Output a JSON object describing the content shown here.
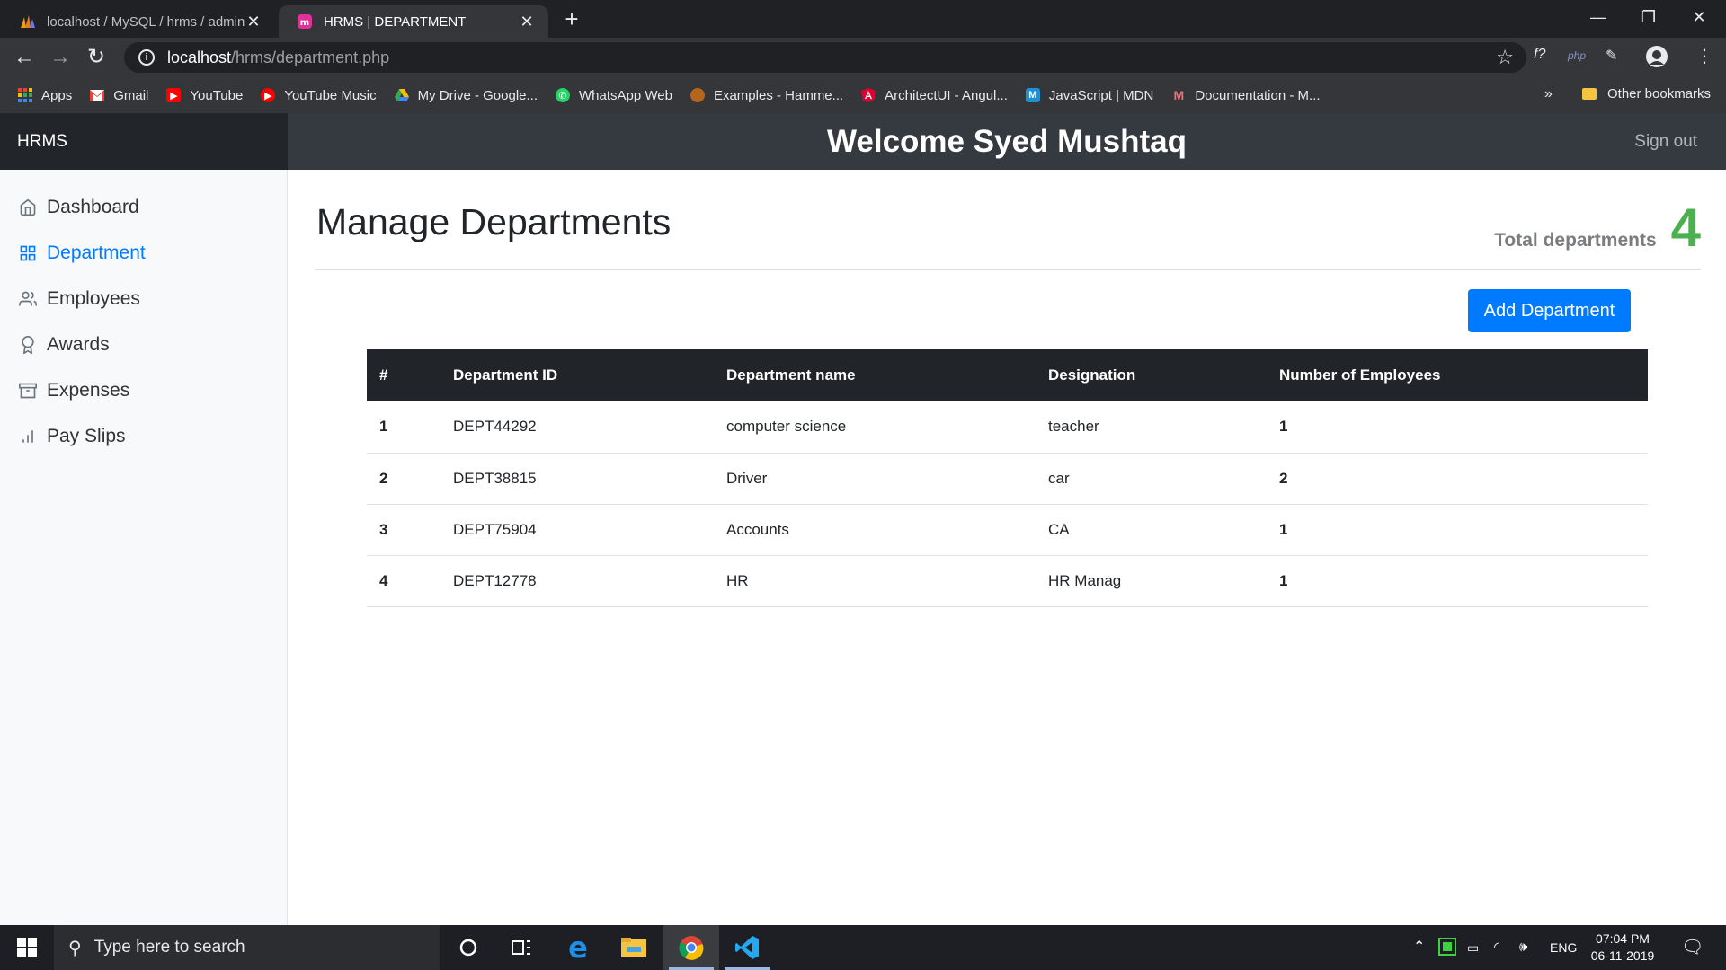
{
  "browser": {
    "tabs": [
      {
        "title": "localhost / MySQL / hrms / admin",
        "active": false,
        "icon": "phpmyadmin-icon"
      },
      {
        "title": "HRMS | DEPARTMENT",
        "active": true,
        "icon": "hrms-favicon-icon"
      }
    ],
    "url_host": "localhost",
    "url_path": "/hrms/department.php",
    "bookmarks": [
      {
        "label": "Apps",
        "icon": "apps-grid-icon",
        "color": "#ea4335"
      },
      {
        "label": "Gmail",
        "icon": "gmail-icon",
        "color": "#ea4335"
      },
      {
        "label": "YouTube",
        "icon": "youtube-icon",
        "color": "#ff0000"
      },
      {
        "label": "YouTube Music",
        "icon": "youtube-music-icon",
        "color": "#ff0000"
      },
      {
        "label": "My Drive - Google...",
        "icon": "google-drive-icon",
        "color": "#34a853"
      },
      {
        "label": "WhatsApp Web",
        "icon": "whatsapp-icon",
        "color": "#25d366"
      },
      {
        "label": "Examples - Hamme...",
        "icon": "hammer-icon",
        "color": "#b5651d"
      },
      {
        "label": "ArchitectUI - Angul...",
        "icon": "angular-icon",
        "color": "#dd0031"
      },
      {
        "label": "JavaScript | MDN",
        "icon": "mdn-icon",
        "color": "#1f8fd6"
      },
      {
        "label": "Documentation - M...",
        "icon": "materialize-icon",
        "color": "#ee6e73"
      }
    ],
    "more_bookmarks": "»",
    "other_bookmarks": "Other bookmarks"
  },
  "app": {
    "brand": "HRMS",
    "welcome": "Welcome Syed Mushtaq",
    "signout": "Sign out"
  },
  "sidebar": {
    "items": [
      {
        "label": "Dashboard",
        "icon": "home-icon",
        "active": false
      },
      {
        "label": "Department",
        "icon": "grid-icon",
        "active": true
      },
      {
        "label": "Employees",
        "icon": "users-icon",
        "active": false
      },
      {
        "label": "Awards",
        "icon": "award-icon",
        "active": false
      },
      {
        "label": "Expenses",
        "icon": "archive-icon",
        "active": false
      },
      {
        "label": "Pay Slips",
        "icon": "bar-chart-icon",
        "active": false
      }
    ]
  },
  "main": {
    "title": "Manage Departments",
    "total_label": "Total departments",
    "total_count": "4",
    "add_button": "Add Department",
    "table": {
      "headers": [
        "#",
        "Department ID",
        "Department name",
        "Designation",
        "Number of Employees"
      ],
      "rows": [
        [
          "1",
          "DEPT44292",
          "computer science",
          "teacher",
          "1"
        ],
        [
          "2",
          "DEPT38815",
          "Driver",
          "car",
          "2"
        ],
        [
          "3",
          "DEPT75904",
          "Accounts",
          "CA",
          "1"
        ],
        [
          "4",
          "DEPT12778",
          "HR",
          "HR Manag",
          "1"
        ]
      ]
    }
  },
  "taskbar": {
    "search_placeholder": "Type here to search",
    "language": "ENG",
    "time": "07:04 PM",
    "date": "06-11-2019"
  },
  "colors": {
    "accent": "#007bff",
    "total_count": "#4caf50",
    "navbar": "#343a40",
    "table_header": "#212529"
  }
}
